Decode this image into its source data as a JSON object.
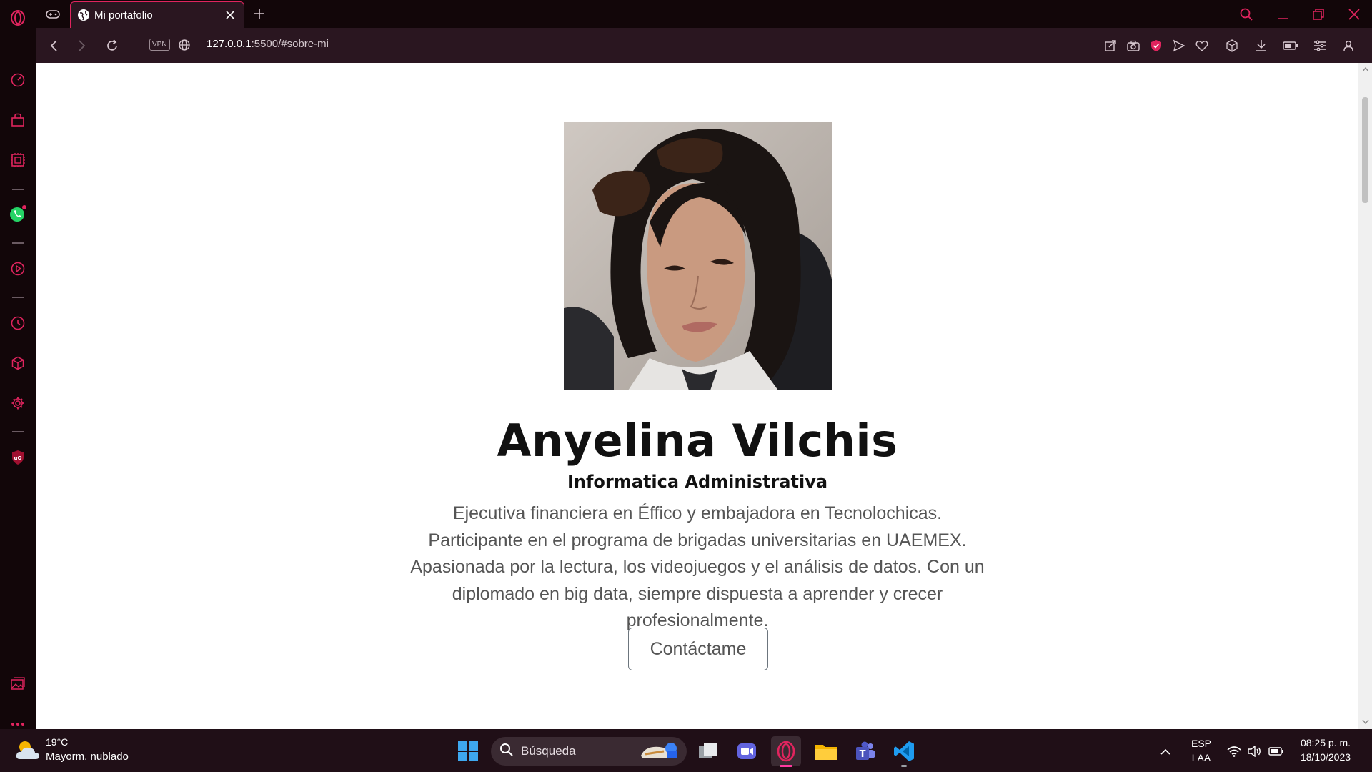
{
  "browser": {
    "tab_title": "Mi portafolio",
    "url_host": "127.0.0.1",
    "url_rest": ":5500/#sobre-mi",
    "vpn_label": "VPN",
    "accent_color": "#e0245e"
  },
  "profile": {
    "name": "Anyelina Vilchis",
    "subtitle": "Informatica Administrativa",
    "bio": "Ejecutiva financiera en Éffico y embajadora en Tecnolochicas. Participante en el programa de brigadas universitarias en UAEMEX. Apasionada por la lectura, los videojuegos y el análisis de datos. Con un diplomado en big data, siempre dispuesta a aprender y crecer profesionalmente.",
    "contact_button": "Contáctame"
  },
  "taskbar": {
    "weather_temp": "19°C",
    "weather_desc": "Mayorm. nublado",
    "search_label": "Búsqueda",
    "lang_1": "ESP",
    "lang_2": "LAA",
    "time": "08:25 p. m.",
    "date": "18/10/2023"
  },
  "icons": {
    "sidebar": [
      "speed-dial-icon",
      "shopping-icon",
      "gx-control-icon",
      "whatsapp-icon",
      "player-icon",
      "history-icon",
      "extensions-icon",
      "settings-icon",
      "ublock-icon",
      "gallery-icon",
      "more-icon"
    ],
    "toolbar": [
      "snapshot-share-icon",
      "camera-icon",
      "adblock-shield-icon",
      "send-icon",
      "heart-icon",
      "cube-icon",
      "download-icon",
      "battery-icon",
      "easy-setup-icon",
      "profile-icon"
    ]
  }
}
